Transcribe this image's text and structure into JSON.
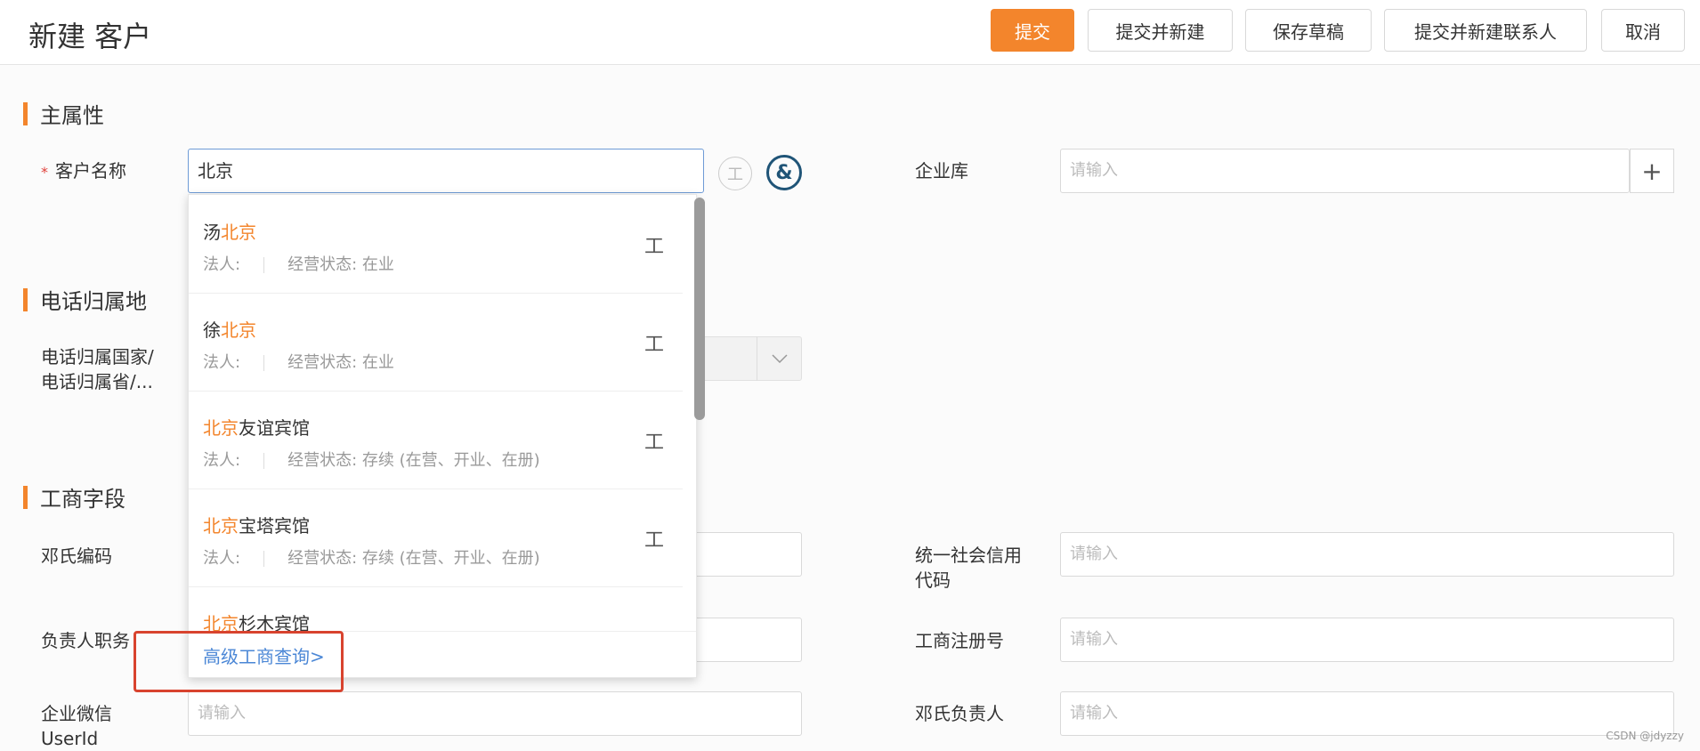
{
  "header": {
    "title": "新建 客户",
    "buttons": {
      "submit": "提交",
      "submit_new": "提交并新建",
      "save_draft": "保存草稿",
      "submit_new_contact": "提交并新建联系人",
      "cancel": "取消"
    }
  },
  "sections": {
    "main": "主属性",
    "phone": "电话归属地",
    "business": "工商字段"
  },
  "fields": {
    "customer_name": {
      "label": "客户名称",
      "required_mark": "*",
      "value": "北京"
    },
    "enterprise_lib": {
      "label": "企业库",
      "placeholder": "请输入",
      "add_icon": "+"
    },
    "phone_country": {
      "label_line1": "电话归属国家/",
      "label_line2": "电话归属省/..."
    },
    "deng_code": {
      "label": "邓氏编码"
    },
    "credit_code": {
      "label_line1": "统一社会信用",
      "label_line2": "代码",
      "placeholder": "请输入"
    },
    "manager_title": {
      "label": "负责人职务"
    },
    "reg_no": {
      "label": "工商注册号",
      "placeholder": "请输入"
    },
    "wechat_userid": {
      "label_line1": "企业微信",
      "label_line2": "UserId",
      "placeholder": "请输入"
    },
    "deng_manager": {
      "label": "邓氏负责人",
      "placeholder": "请输入"
    }
  },
  "dropdown": {
    "items": [
      {
        "prefix": "汤",
        "highlight": "北京",
        "suffix": "",
        "legal_label": "法人:",
        "status": "经营状态: 在业",
        "icon": "工"
      },
      {
        "prefix": "徐",
        "highlight": "北京",
        "suffix": "",
        "legal_label": "法人:",
        "status": "经营状态: 在业",
        "icon": "工"
      },
      {
        "prefix": "",
        "highlight": "北京",
        "suffix": "友谊宾馆",
        "legal_label": "法人:",
        "status": "经营状态: 存续 (在营、开业、在册)",
        "icon": "工"
      },
      {
        "prefix": "",
        "highlight": "北京",
        "suffix": "宝塔宾馆",
        "legal_label": "法人:",
        "status": "经营状态: 存续 (在营、开业、在册)",
        "icon": "工"
      },
      {
        "prefix": "",
        "highlight": "北京",
        "suffix": "杉木宾馆",
        "legal_label": "",
        "status": "",
        "icon": ""
      }
    ],
    "footer_link": "高级工商查询>"
  },
  "icons": {
    "gongshang": "工",
    "deng": "&"
  },
  "watermark": "CSDN @jdyzzy",
  "colors": {
    "accent": "#f3852c",
    "link": "#4b87d6",
    "highlight_box": "#d8432e"
  }
}
